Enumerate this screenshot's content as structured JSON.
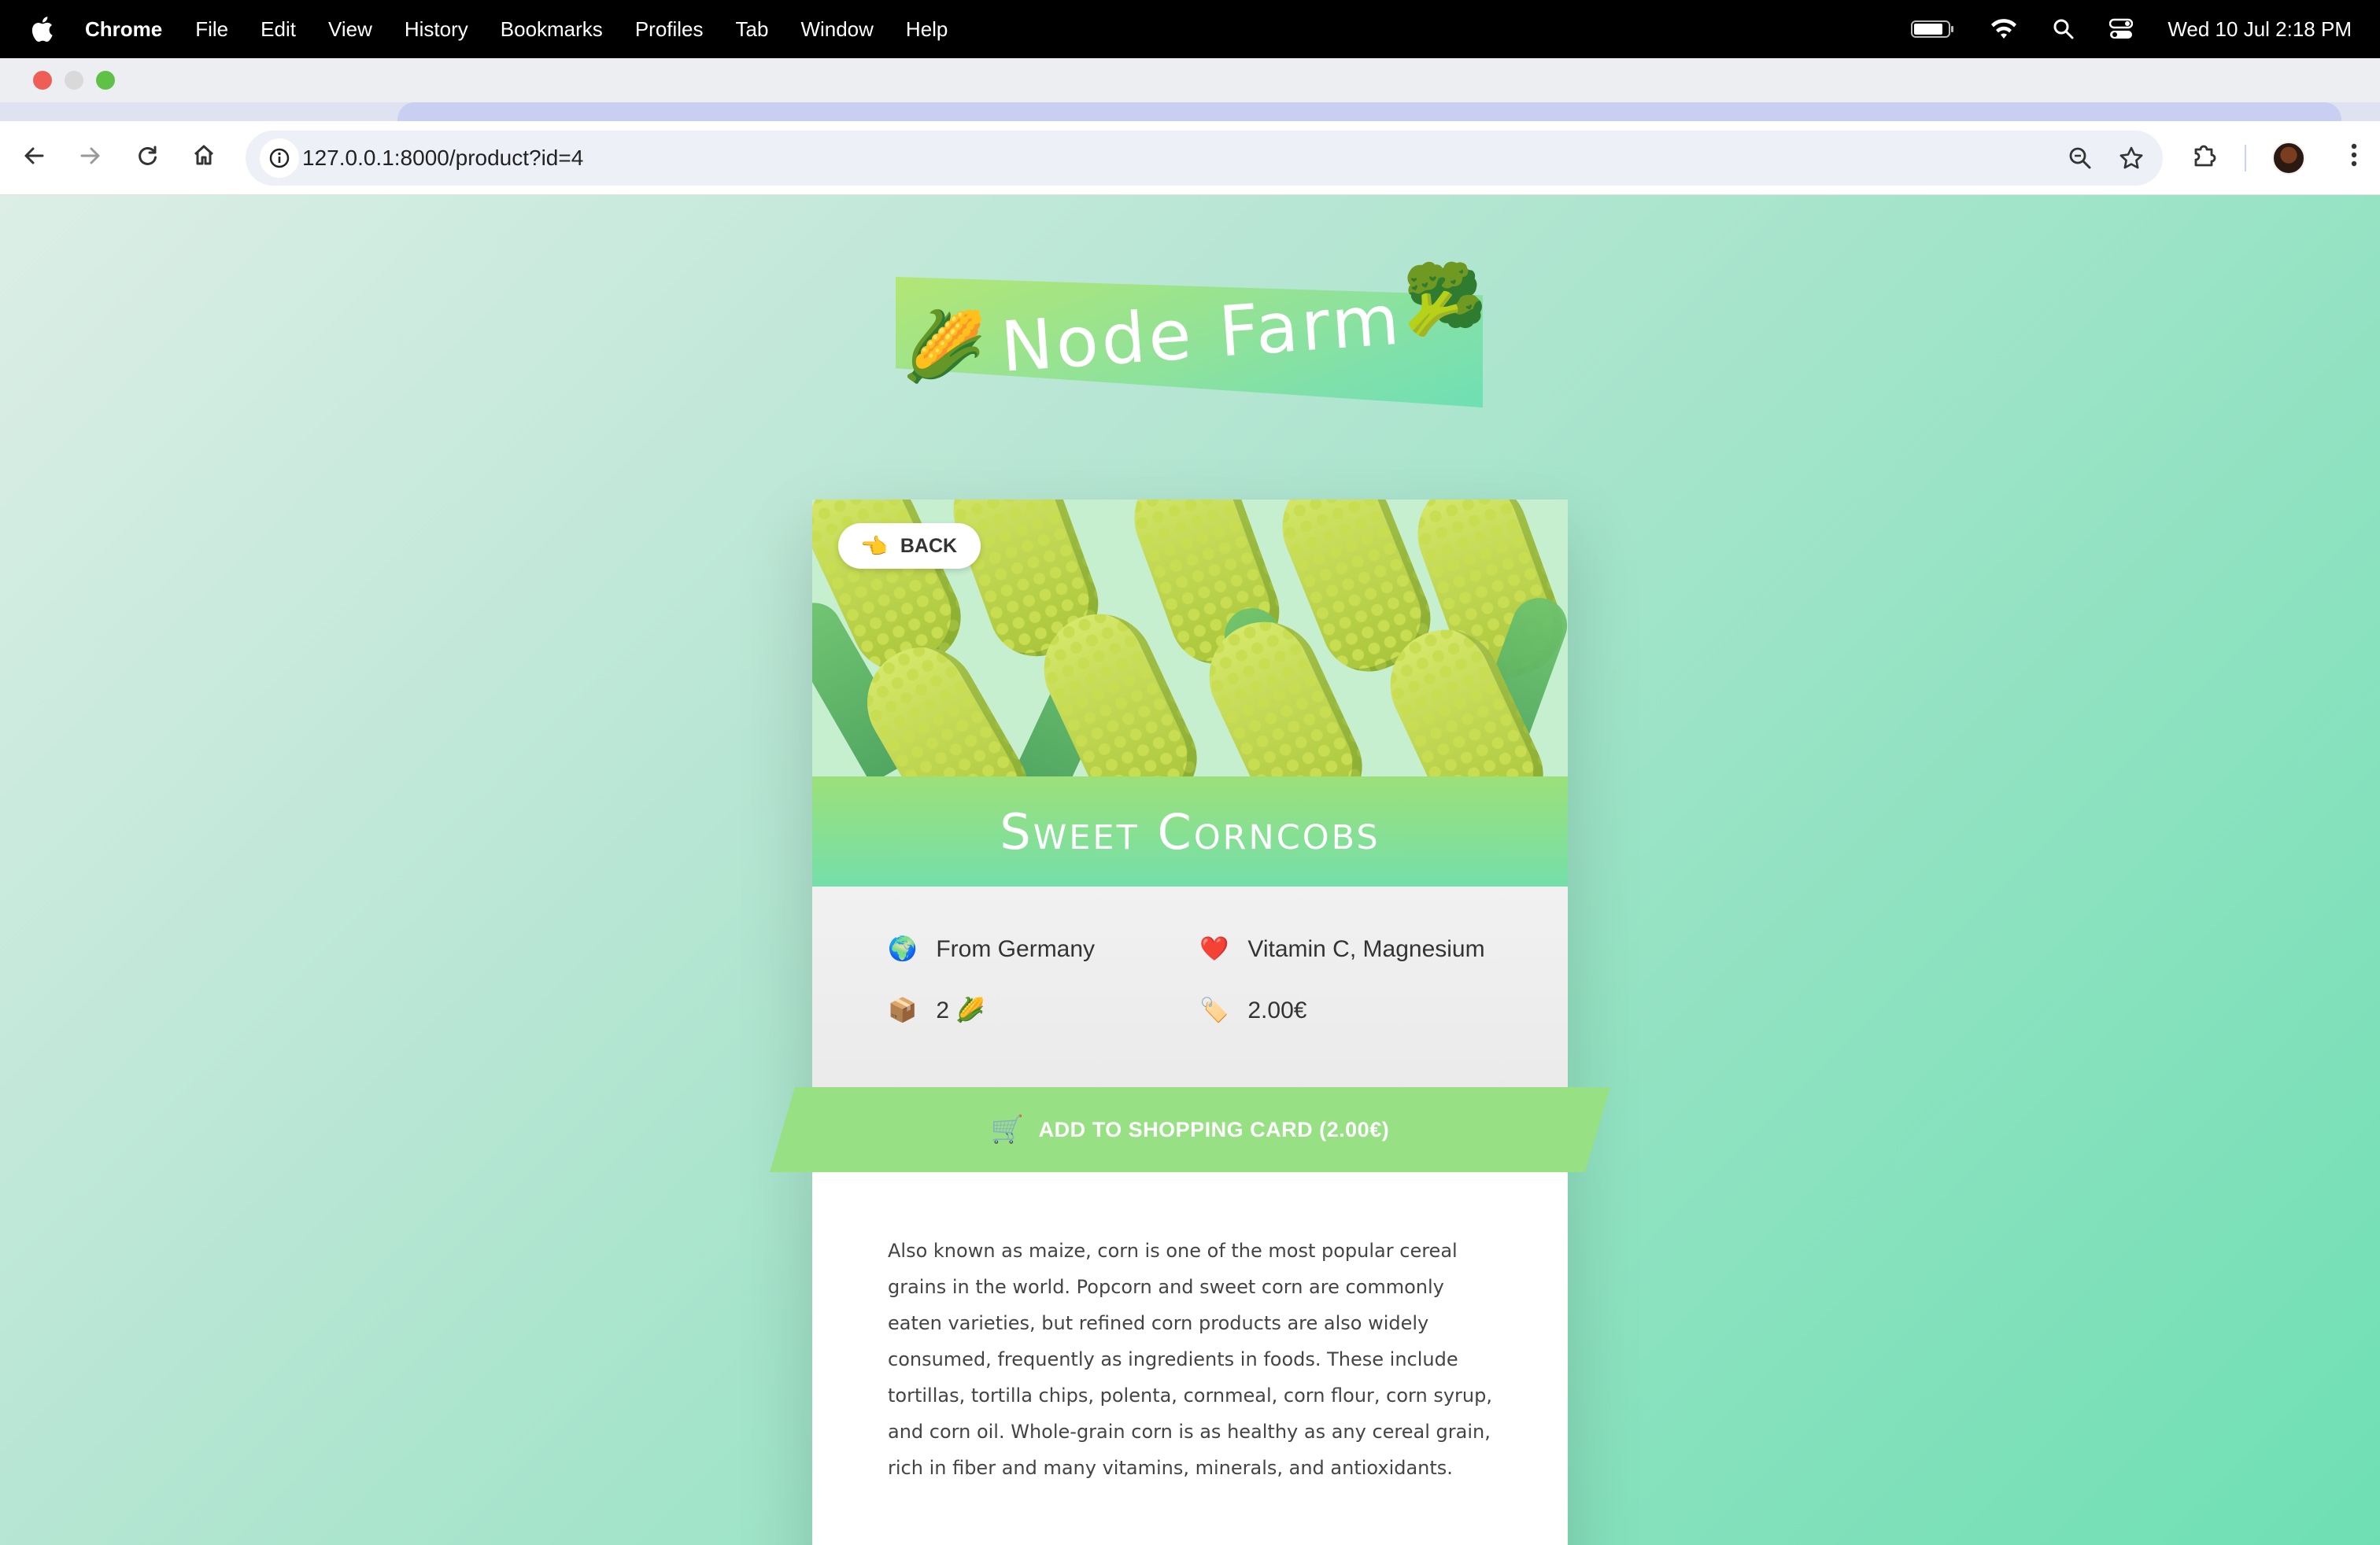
{
  "menubar": {
    "app_name": "Chrome",
    "items": [
      "File",
      "Edit",
      "View",
      "History",
      "Bookmarks",
      "Profiles",
      "Tab",
      "Window",
      "Help"
    ],
    "clock": "Wed 10 Jul  2:18 PM"
  },
  "browser": {
    "url": "127.0.0.1:8000/product?id=4",
    "icons": {
      "back": "arrow-left-icon",
      "forward": "arrow-right-icon",
      "reload": "reload-icon",
      "home": "home-icon",
      "site_info": "info-icon",
      "zoom": "zoom-icon",
      "bookmark": "star-icon",
      "extensions": "puzzle-icon",
      "menu": "kebab-icon"
    }
  },
  "site": {
    "logo_text": "Node Farm",
    "logo_emoji_left": "🌽",
    "logo_emoji_right": "🥦"
  },
  "product": {
    "back_label": "BACK",
    "back_emoji": "👈",
    "name": "Sweet Corncobs",
    "from": "From Germany",
    "from_emoji": "🌍",
    "nutrients": "Vitamin C, Magnesium",
    "nutrients_emoji": "❤️",
    "quantity": "2 🌽",
    "quantity_emoji": "📦",
    "price": "2.00€",
    "price_emoji": "🏷️",
    "add_to_cart_label": "ADD TO SHOPPING CARD (2.00€)",
    "cart_emoji": "🛒",
    "description": "Also known as maize, corn is one of the most popular cereal grains in the world. Popcorn and sweet corn are commonly eaten varieties, but refined corn products are also widely consumed, frequently as ingredients in foods. These include tortillas, tortilla chips, polenta, cornmeal, corn flour, corn syrup, and corn oil. Whole-grain corn is as healthy as any cereal grain, rich in fiber and many vitamins, minerals, and antioxidants."
  },
  "colors": {
    "accent_green": "#97e083",
    "gradient_end": "#6fdfb3"
  }
}
